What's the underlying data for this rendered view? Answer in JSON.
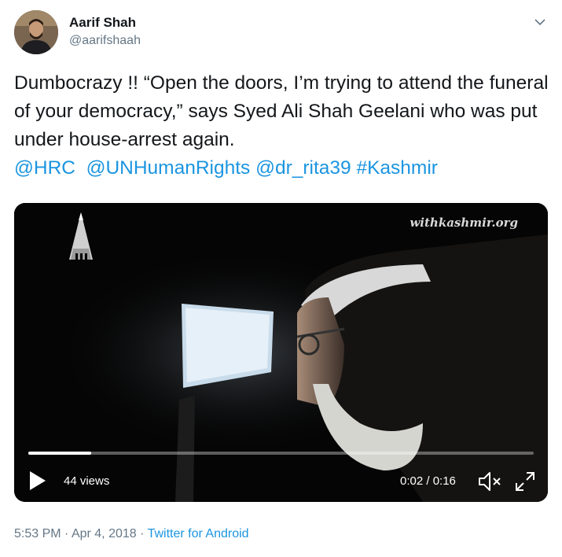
{
  "author": {
    "name": "Aarif Shah",
    "handle": "@aarifshaah"
  },
  "tweet": {
    "text_plain": "Dumbocrazy !! “Open the doors, I’m trying to attend the funeral of your democracy,” says Syed Ali Shah Geelani who was put under house-arrest again.",
    "mentions": [
      "@HRC",
      "@UNHumanRights",
      "@dr_rita39"
    ],
    "hashtag": "#Kashmir"
  },
  "video": {
    "watermark": "withkashmir.org",
    "views": "44 views",
    "time": "0:02 / 0:16",
    "progress_fraction": 0.125
  },
  "meta": {
    "time": "5:53 PM",
    "date": "Apr 4, 2018",
    "separator": " · ",
    "source": "Twitter for Android"
  },
  "colors": {
    "link": "#1b95e0",
    "secondary_text": "#657786"
  },
  "icons": {
    "caret": "chevron-down-icon",
    "play": "play-icon",
    "mute": "volume-muted-icon",
    "fullscreen": "fullscreen-icon"
  }
}
